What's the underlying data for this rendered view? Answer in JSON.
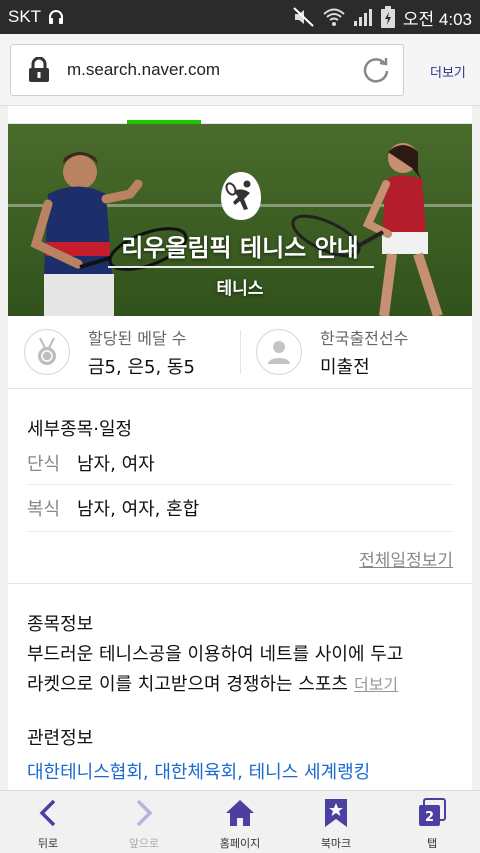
{
  "status_bar": {
    "carrier": "SKT",
    "time": "오전 4:03"
  },
  "browser": {
    "url": "m.search.naver.com",
    "more_label": "더보기"
  },
  "hero": {
    "title": "리우올림픽 테니스 안내",
    "subtitle": "테니스"
  },
  "medals": {
    "label": "할당된 메달 수",
    "value": "금5, 은5, 동5"
  },
  "korea": {
    "label": "한국출전선수",
    "value": "미출전"
  },
  "schedule": {
    "title": "세부종목·일정",
    "rows": [
      {
        "key": "단식",
        "value": "남자, 여자"
      },
      {
        "key": "복식",
        "value": "남자, 여자, 혼합"
      }
    ],
    "full_link": "전체일정보기"
  },
  "info": {
    "title": "종목정보",
    "line1": "부드러운 테니스공을 이용하여 네트를 사이에 두고",
    "line2": "라켓으로 이를 치고받으며 경쟁하는 스포츠",
    "more": "더보기"
  },
  "related": {
    "title": "관련정보",
    "links": "대한테니스협회, 대한체육회, 테니스 세계랭킹"
  },
  "bottom_nav": {
    "back": "뒤로",
    "forward": "앞으로",
    "home": "홈페이지",
    "bookmark": "북마크",
    "tabs": "탭",
    "tab_count": "2"
  },
  "colors": {
    "accent_green": "#1ec800",
    "nav_purple": "#4b3fa0",
    "link_blue": "#1a6ad1"
  }
}
